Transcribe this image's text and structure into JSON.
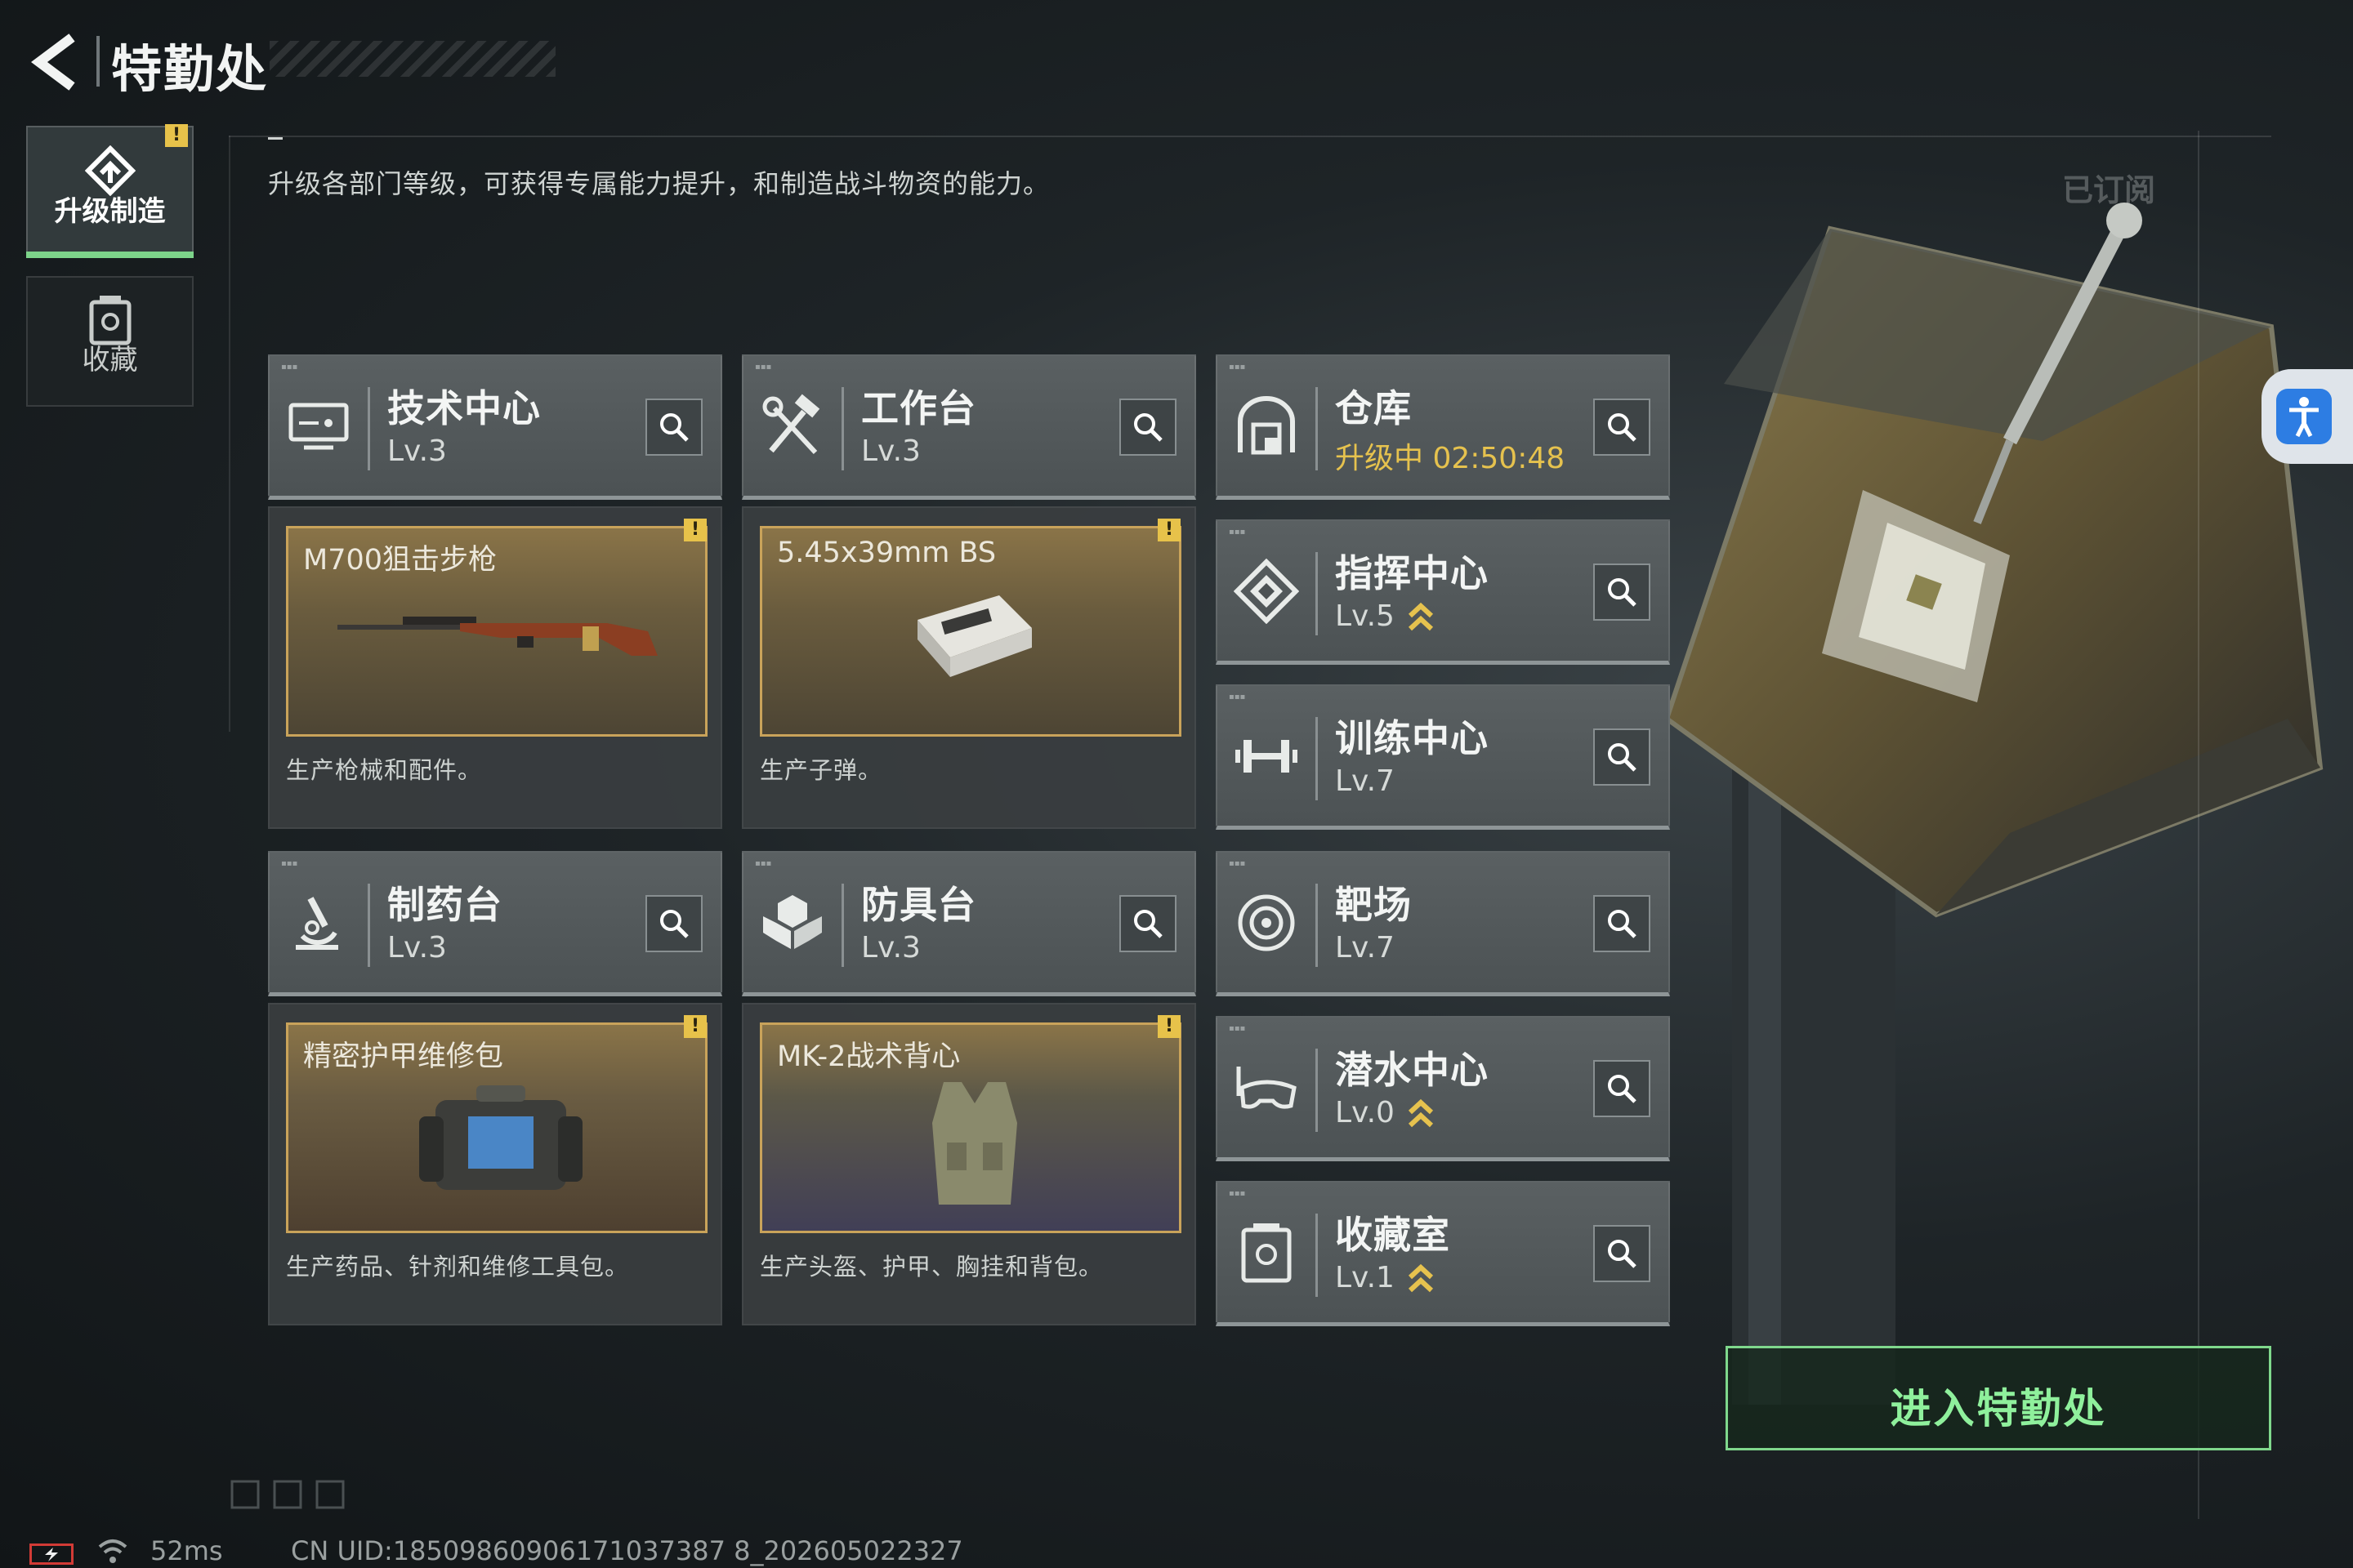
{
  "header": {
    "title": "特勤处"
  },
  "side_tabs": [
    {
      "label": "升级制造",
      "warn": "!"
    },
    {
      "label": "收藏"
    }
  ],
  "description": "升级各部门等级，可获得专属能力提升，和制造战斗物资的能力。",
  "subscribed_label": "已订阅",
  "facilities": {
    "tech": {
      "name": "技术中心",
      "level": "Lv.3",
      "icon": "monitor-icon"
    },
    "workbench": {
      "name": "工作台",
      "level": "Lv.3",
      "icon": "tools-icon"
    },
    "warehouse": {
      "name": "仓库",
      "status": "升级中 02:50:48",
      "icon": "warehouse-icon"
    },
    "command": {
      "name": "指挥中心",
      "level": "Lv.5",
      "icon": "command-icon",
      "upgradable": true
    },
    "training": {
      "name": "训练中心",
      "level": "Lv.7",
      "icon": "dumbbell-icon"
    },
    "pharmacy": {
      "name": "制药台",
      "level": "Lv.3",
      "icon": "microscope-icon"
    },
    "armor": {
      "name": "防具台",
      "level": "Lv.3",
      "icon": "armor-icon"
    },
    "range": {
      "name": "靶场",
      "level": "Lv.7",
      "icon": "target-icon"
    },
    "diving": {
      "name": "潜水中心",
      "level": "Lv.0",
      "icon": "diving-mask-icon",
      "upgradable": true
    },
    "collection": {
      "name": "收藏室",
      "level": "Lv.1",
      "icon": "collection-icon",
      "upgradable": true
    }
  },
  "products": {
    "tech": {
      "item": "M700狙击步枪",
      "desc": "生产枪械和配件。",
      "warn": "!"
    },
    "workbench": {
      "item": "5.45x39mm BS",
      "desc": "生产子弹。",
      "warn": "!"
    },
    "pharmacy": {
      "item": "精密护甲维修包",
      "desc": "生产药品、针剂和维修工具包。",
      "warn": "!"
    },
    "armor": {
      "item": "MK-2战术背心",
      "desc": "生产头盔、护甲、胸挂和背包。",
      "warn": "!"
    }
  },
  "enter_button": "进入特勤处",
  "footer": {
    "ping": "52ms",
    "uid": "CN UID:18509860906171037387 8_202605022327"
  },
  "colors": {
    "accent_green": "#7fd88c",
    "gold": "#e6c24e",
    "warn_yellow": "#e7c24a"
  }
}
